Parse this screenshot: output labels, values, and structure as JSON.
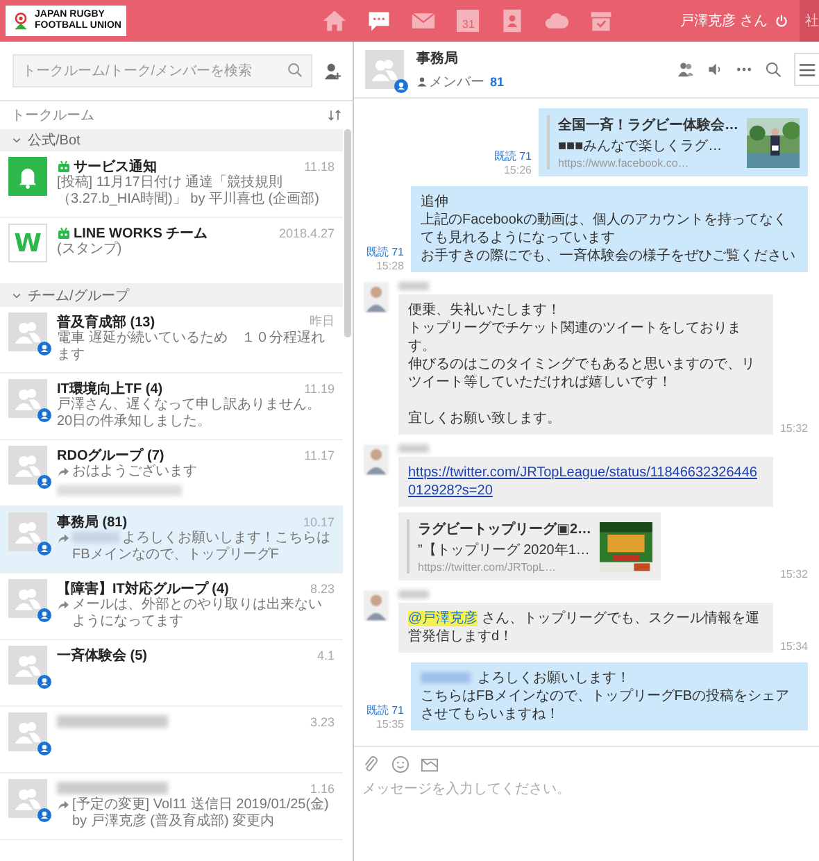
{
  "header": {
    "logo_lines": [
      "JAPAN RUGBY",
      "FOOTBALL UNION"
    ],
    "nav": [
      {
        "kind": "home",
        "selected": false
      },
      {
        "kind": "talk",
        "selected": true
      },
      {
        "kind": "mail",
        "selected": false
      },
      {
        "kind": "calendar",
        "selected": false,
        "label": "31"
      },
      {
        "kind": "contacts",
        "selected": false
      },
      {
        "kind": "cloud",
        "selected": false
      },
      {
        "kind": "task",
        "selected": false
      }
    ],
    "user": "戸澤克彦 さん",
    "company_tab": "社"
  },
  "sidebar": {
    "search": {
      "placeholder": "トークルーム/トーク/メンバーを検索"
    },
    "list_label": "トークルーム",
    "sections": [
      {
        "title": "公式/Bot",
        "expanded": true,
        "rooms": [
          {
            "kind": "bell",
            "bot": true,
            "title": "サービス通知",
            "date": "11.18",
            "selected": false,
            "preview": "[投稿] 11月17日付け 通達「競技規則（3.27.b_HIA時間)」 by 平川喜也 (企画部)"
          },
          {
            "kind": "lineworks",
            "avatar_text": "W",
            "bot": true,
            "title": "LINE WORKS チーム",
            "date": "2018.4.27",
            "selected": false,
            "preview": "(スタンプ)"
          }
        ]
      },
      {
        "title": "チーム/グループ",
        "expanded": true,
        "rooms": [
          {
            "kind": "group",
            "bot": false,
            "title": "普及育成部 (13)",
            "date": "昨日",
            "selected": false,
            "preview": "電車 遅延が続いているため　１０分程遅れます"
          },
          {
            "kind": "group",
            "bot": false,
            "title": "IT環境向上TF (4)",
            "date": "11.19",
            "selected": false,
            "preview": "戸澤さん、遅くなって申し訳ありません。20日の件承知しました。"
          },
          {
            "kind": "group",
            "bot": false,
            "title": "RDOグループ (7)",
            "date": "11.17",
            "selected": false,
            "forwarded": true,
            "preview": "おはようございます",
            "redacted_line": true
          },
          {
            "kind": "group",
            "bot": false,
            "title": "事務局 (81)",
            "date": "10.17",
            "selected": true,
            "forwarded": true,
            "redacted_prefix": true,
            "preview": "よろしくお願いします！こちらはFBメインなので、トップリーグF"
          },
          {
            "kind": "group",
            "bot": false,
            "title": "【障害】IT対応グループ (4)",
            "date": "8.23",
            "selected": false,
            "forwarded": true,
            "preview": "メールは、外部とのやり取りは出来ないようになってます"
          },
          {
            "kind": "group",
            "bot": false,
            "title": "一斉体験会 (5)",
            "date": "4.1",
            "selected": false
          },
          {
            "kind": "group",
            "bot": false,
            "title_redacted": true,
            "date": "3.23",
            "selected": false
          },
          {
            "kind": "group",
            "bot": false,
            "title_redacted": true,
            "date": "1.16",
            "selected": false,
            "forwarded": true,
            "preview": "[予定の変更] Vol11 送信日 2019/01/25(金) by 戸澤克彦 (普及育成部) 変更内"
          }
        ]
      }
    ]
  },
  "chat": {
    "room": {
      "name": "事務局",
      "members_label": "メンバー",
      "members_count": "81"
    },
    "messages": [
      {
        "kind": "link_card",
        "own": true,
        "read": "既読 71",
        "time": "15:26",
        "card": {
          "title": "全国一斉！ラグビー体験会…",
          "description": "■■■みんなで楽しくラグ…",
          "url": "https://www.facebook.co…"
        }
      },
      {
        "kind": "text",
        "own": true,
        "read": "既読 71",
        "time": "15:28",
        "paragraphs": [
          [
            "追伸",
            "上記のFacebookの動画は、個人のアカウントを持ってなくても見れるようになっています",
            "お手すきの際にでも、一斉体験会の様子をぜひご覧ください"
          ]
        ]
      },
      {
        "kind": "text",
        "own": false,
        "sender_redacted": true,
        "time": "15:32",
        "paragraphs": [
          [
            "便乗、失礼いたします！",
            "トップリーグでチケット関連のツイートをしております。",
            "伸びるのはこのタイミングでもあると思いますので、リツイート等していただければ嬉しいです！"
          ],
          [
            "宜しくお願い致します。"
          ]
        ]
      },
      {
        "kind": "link",
        "own": false,
        "sender_redacted": true,
        "time": "15:32",
        "url": "https://twitter.com/JRTopLeague/status/11846632326446012928?s=20",
        "card": {
          "title": "ラグビートップリーグ▣2…",
          "description": "”【トップリーグ 2020年1…",
          "url": "https://twitter.com/JRTopL…"
        }
      },
      {
        "kind": "text",
        "own": false,
        "sender_redacted": true,
        "time": "15:34",
        "mention": "@戸澤克彦",
        "paragraphs": [
          [
            " さん、トップリーグでも、スクール情報を運営発信しますd！"
          ]
        ]
      },
      {
        "kind": "text",
        "own": true,
        "read": "既読 71",
        "time": "15:35",
        "redacted_prefix": true,
        "paragraphs": [
          [
            " よろしくお願いします！",
            "こちらはFBメインなので、トップリーグFBの投稿をシェアさせてもらいますね！"
          ]
        ]
      }
    ],
    "composer": {
      "placeholder": "メッセージを入力してください。"
    }
  }
}
